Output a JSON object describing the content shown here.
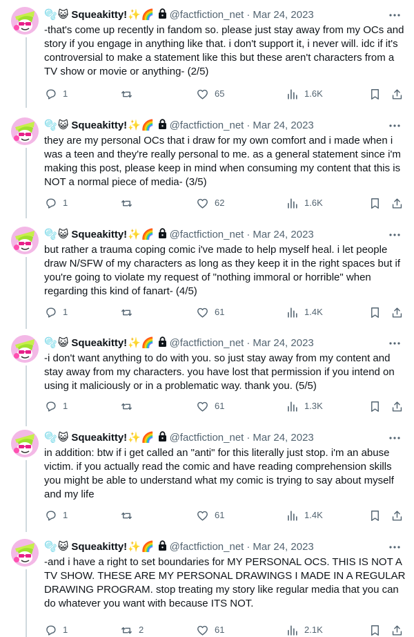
{
  "author": {
    "badge_emojis": [
      "🫧",
      "😺"
    ],
    "display_name": "Squeakitty!",
    "name_emojis": [
      "✨",
      "🌈"
    ],
    "handle": "@factfiction_net",
    "separator": "·",
    "date": "Mar 24, 2023"
  },
  "icons": {
    "more": "more-dots-icon",
    "reply": "reply-icon",
    "retweet": "retweet-icon",
    "like": "heart-icon",
    "views": "views-icon",
    "bookmark": "bookmark-icon",
    "share": "share-icon",
    "lock": "lock-icon"
  },
  "colors": {
    "text": "#0f1419",
    "secondary": "#536471",
    "thread_line": "#cfd9de",
    "divider": "#eff3f4"
  },
  "tweets": [
    {
      "text": "-that's come up recently in fandom so. please just stay away from my OCs and story if you engage in anything like that. i don't support it, i never will. idc if it's controversial to make a statement like this but these aren't characters from a TV show or movie or anything- (2/5)",
      "replies": "1",
      "retweets": "",
      "likes": "65",
      "views": "1.6K"
    },
    {
      "text": "they are my personal OCs that i draw for my own comfort and i made when i was a teen and they're really personal to me. as a general statement since i'm making this post, please keep in mind when consuming my content that this is NOT a normal piece of media- (3/5)",
      "replies": "1",
      "retweets": "",
      "likes": "62",
      "views": "1.6K"
    },
    {
      "text": "but rather a trauma coping comic i've made to help myself heal. i let people draw N/SFW of my characters as long as they keep it in the right spaces but if you're going to violate my request of \"nothing immoral or horrible\" when regarding this kind of fanart- (4/5)",
      "replies": "1",
      "retweets": "",
      "likes": "61",
      "views": "1.4K"
    },
    {
      "text": "-i don't want anything to do with you. so just stay away from my content and stay away from my characters. you have lost that permission if you intend on using it maliciously or in a problematic way. thank you. (5/5)",
      "replies": "1",
      "retweets": "",
      "likes": "61",
      "views": "1.3K"
    },
    {
      "text": "in addition: btw if i get called an \"anti\" for this literally just stop. i'm an abuse victim. if you actually read the comic and have reading comprehension skills you might be able to understand what my comic is trying to say about myself and my life",
      "replies": "1",
      "retweets": "",
      "likes": "61",
      "views": "1.4K"
    },
    {
      "text": "-and i have a right to set boundaries for MY PERSONAL OCS. THIS IS NOT A TV SHOW. THESE ARE MY PERSONAL DRAWINGS I MADE IN A REGULAR DRAWING PROGRAM. stop treating my story like regular media that you can do whatever you want with because ITS NOT.",
      "replies": "1",
      "retweets": "2",
      "likes": "61",
      "views": "2.1K"
    }
  ]
}
